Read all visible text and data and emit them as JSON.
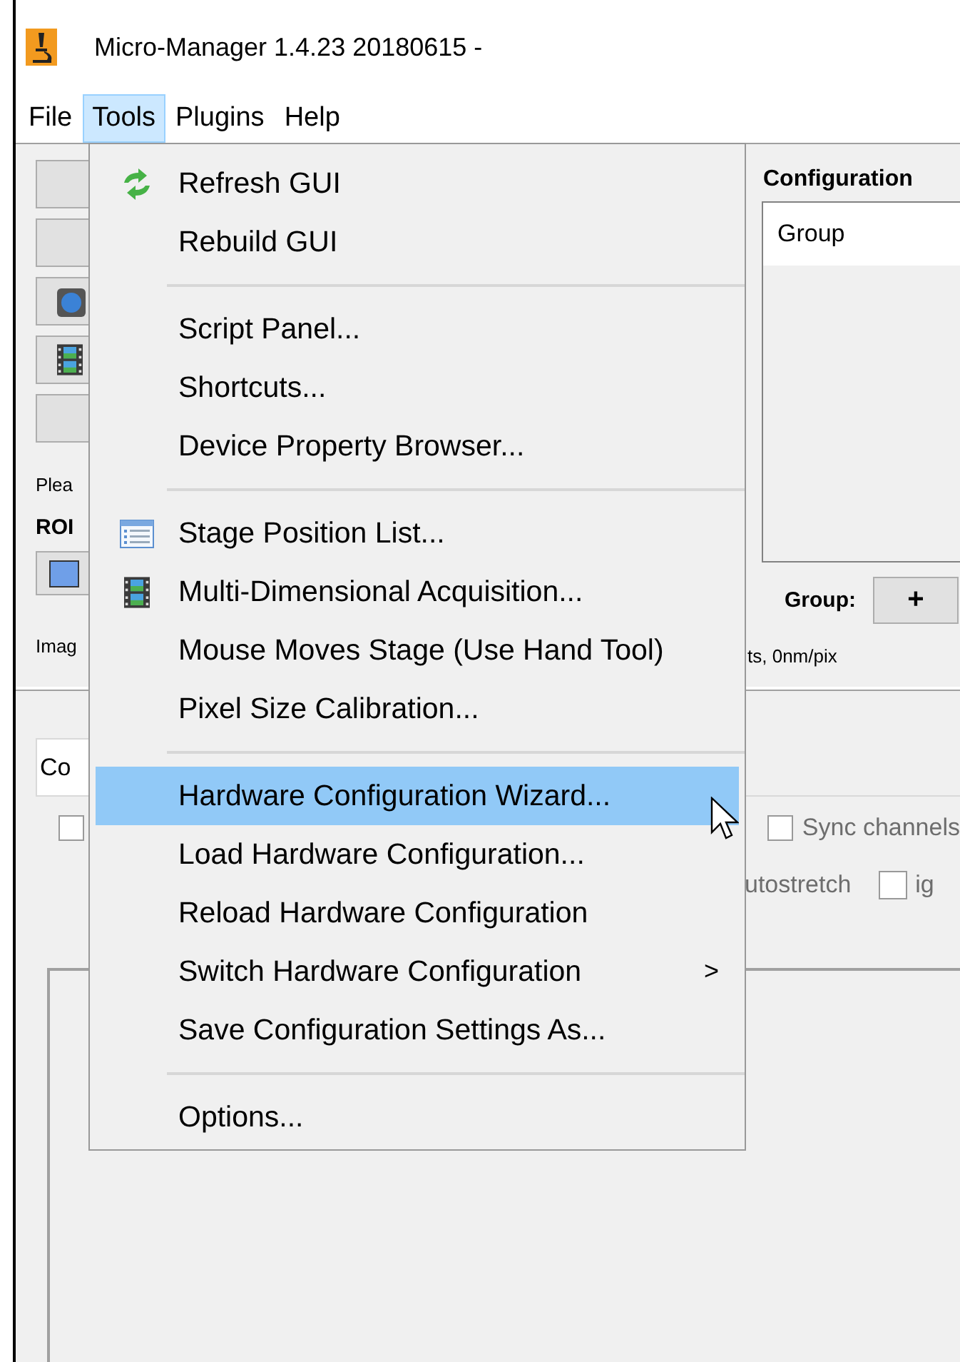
{
  "window": {
    "title": "Micro-Manager 1.4.23 20180615 -"
  },
  "menu_bar": [
    {
      "label": "File",
      "selected": false
    },
    {
      "label": "Tools",
      "selected": true
    },
    {
      "label": "Plugins",
      "selected": false
    },
    {
      "label": "Help",
      "selected": false
    }
  ],
  "main_panel": {
    "status_text": "Plea",
    "roi_label": "ROI",
    "image_info_left": "Imag",
    "configuration_title": "Configuration",
    "group_list": [
      {
        "label": "Group"
      }
    ],
    "group_label": "Group:",
    "add_group_button": "+",
    "image_info_right": "ts, 0nm/pix"
  },
  "lower_panel": {
    "tab_label": "Co",
    "left_checkbox": {
      "checked": false
    },
    "sync_checkbox": {
      "label": "Sync channels",
      "checked": false
    },
    "autostretch_label": "utostretch",
    "ignore_checkbox": {
      "label": "ig",
      "checked": false
    }
  },
  "tools_menu": [
    {
      "kind": "refresh",
      "label": "Refresh GUI",
      "selected": false
    },
    {
      "kind": "item",
      "label": "Rebuild GUI",
      "selected": false
    },
    {
      "kind": "separator"
    },
    {
      "kind": "item",
      "label": "Script Panel...",
      "selected": false
    },
    {
      "kind": "item",
      "label": "Shortcuts...",
      "selected": false
    },
    {
      "kind": "item",
      "label": "Device Property Browser...",
      "selected": false
    },
    {
      "kind": "separator"
    },
    {
      "kind": "list",
      "label": "Stage Position List...",
      "selected": false
    },
    {
      "kind": "film",
      "label": "Multi-Dimensional Acquisition...",
      "selected": false
    },
    {
      "kind": "item",
      "label": "Mouse Moves Stage (Use Hand Tool)",
      "selected": false
    },
    {
      "kind": "item",
      "label": "Pixel Size Calibration...",
      "selected": false
    },
    {
      "kind": "separator"
    },
    {
      "kind": "item",
      "label": "Hardware Configuration Wizard...",
      "selected": true
    },
    {
      "kind": "item",
      "label": "Load Hardware Configuration...",
      "selected": false
    },
    {
      "kind": "item",
      "label": "Reload Hardware Configuration",
      "selected": false
    },
    {
      "kind": "submenu",
      "label": "Switch Hardware Configuration",
      "selected": false,
      "submenu_arrow": ">"
    },
    {
      "kind": "item",
      "label": "Save Configuration Settings As...",
      "selected": false
    },
    {
      "kind": "separator"
    },
    {
      "kind": "item",
      "label": "Options...",
      "selected": false
    }
  ]
}
